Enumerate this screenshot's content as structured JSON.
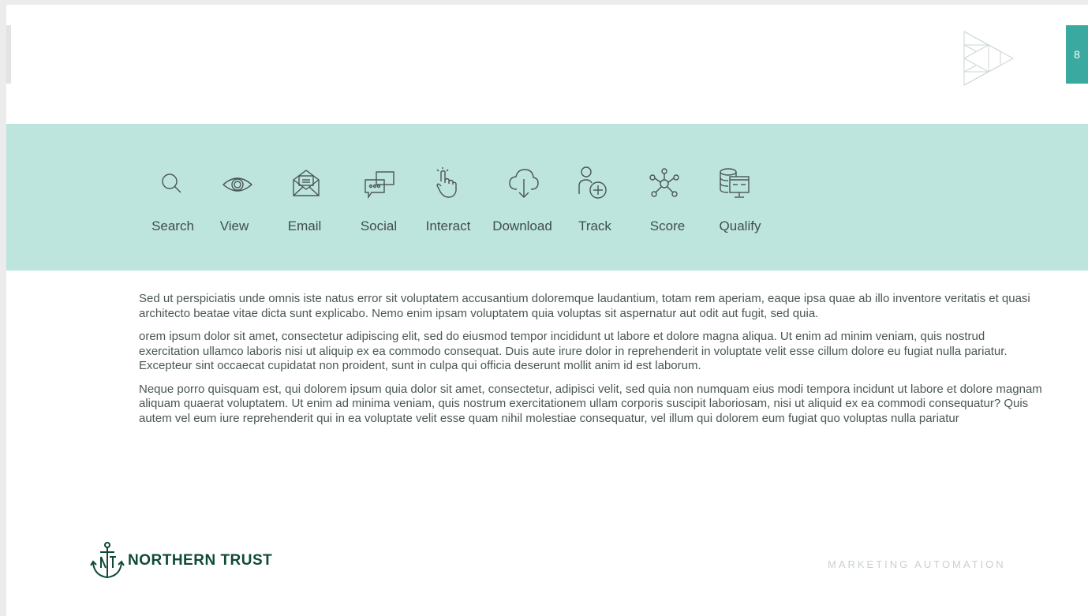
{
  "page_number": "8",
  "process_steps": [
    {
      "label": "Search",
      "icon": "search-icon"
    },
    {
      "label": "View",
      "icon": "eye-icon"
    },
    {
      "label": "Email",
      "icon": "email-icon"
    },
    {
      "label": "Social",
      "icon": "chat-bubbles-icon"
    },
    {
      "label": "Interact",
      "icon": "tap-hand-icon"
    },
    {
      "label": "Download",
      "icon": "cloud-download-icon"
    },
    {
      "label": "Track",
      "icon": "add-person-icon"
    },
    {
      "label": "Score",
      "icon": "network-nodes-icon"
    },
    {
      "label": "Qualify",
      "icon": "database-screen-icon"
    }
  ],
  "paragraphs": [
    "Sed ut perspiciatis unde omnis iste natus error sit voluptatem accusantium doloremque laudantium, totam rem aperiam, eaque ipsa quae ab illo inventore veritatis et quasi architecto beatae vitae dicta sunt explicabo. Nemo enim ipsam voluptatem quia voluptas sit aspernatur aut odit aut fugit, sed quia.",
    "orem ipsum dolor sit amet, consectetur adipiscing elit, sed do eiusmod tempor incididunt ut labore et dolore magna aliqua. Ut enim ad minim veniam, quis nostrud exercitation ullamco laboris nisi ut aliquip ex ea commodo consequat. Duis aute irure dolor in reprehenderit in voluptate velit esse cillum dolore eu fugiat nulla pariatur. Excepteur sint occaecat cupidatat non proident, sunt in culpa qui officia deserunt mollit anim id est laborum.",
    "Neque porro quisquam est, qui dolorem ipsum quia dolor sit amet, consectetur, adipisci velit, sed quia non numquam eius modi tempora incidunt ut labore et dolore magnam aliquam quaerat voluptatem. Ut enim ad minima veniam, quis nostrum exercitationem ullam corporis suscipit laboriosam, nisi ut aliquid ex ea commodi consequatur? Quis autem vel eum iure reprehenderit qui in ea voluptate velit esse quam nihil molestiae consequatur, vel illum qui dolorem eum fugiat quo voluptas nulla pariatur"
  ],
  "logo": {
    "text": "NORTHERN TRUST",
    "icon": "anchor-logo-icon"
  },
  "footer": {
    "section_label": "MARKETING AUTOMATION"
  },
  "colors": {
    "band": "#bde5de",
    "accent": "#3aa9a0",
    "brand_green": "#0f4a34"
  }
}
